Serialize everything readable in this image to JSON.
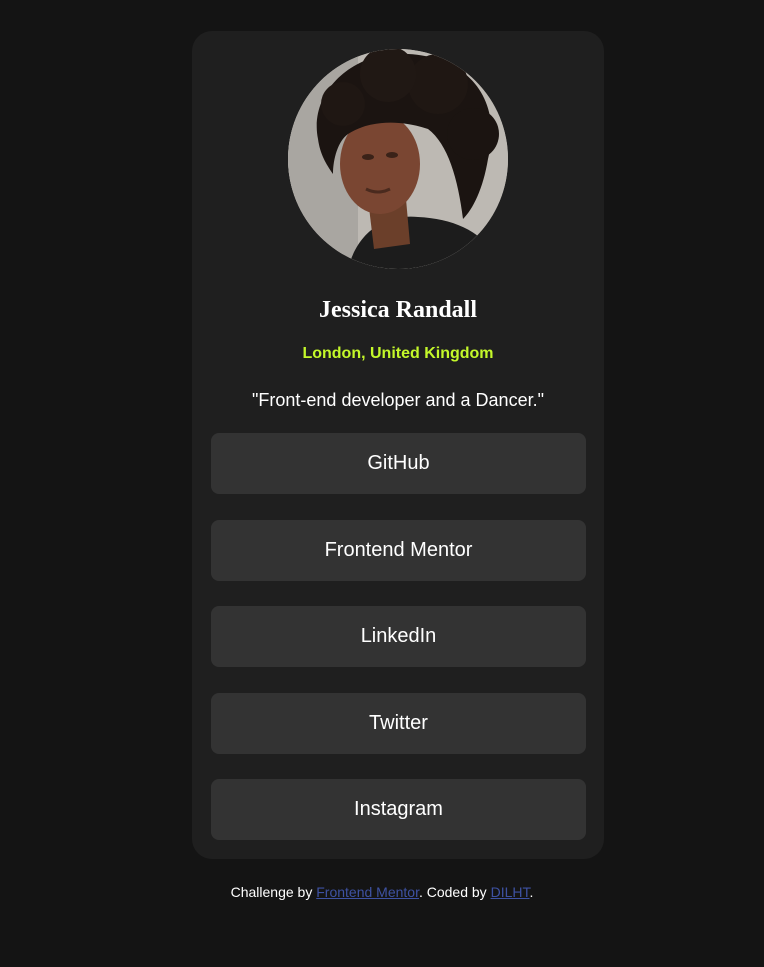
{
  "profile": {
    "name": "Jessica Randall",
    "location": "London, United Kingdom",
    "bio": "\"Front-end developer and a Dancer.\""
  },
  "links": [
    {
      "label": "GitHub"
    },
    {
      "label": "Frontend Mentor"
    },
    {
      "label": "LinkedIn"
    },
    {
      "label": "Twitter"
    },
    {
      "label": "Instagram"
    }
  ],
  "footer": {
    "prefix": "Challenge by ",
    "challenge_link": "Frontend Mentor",
    "middle": ". Coded by ",
    "author_link": "DILHT",
    "suffix": "."
  },
  "colors": {
    "background": "#141414",
    "card": "#1f1f1f",
    "button": "#333333",
    "accent": "#c4f82a",
    "link": "#3e52a3"
  }
}
